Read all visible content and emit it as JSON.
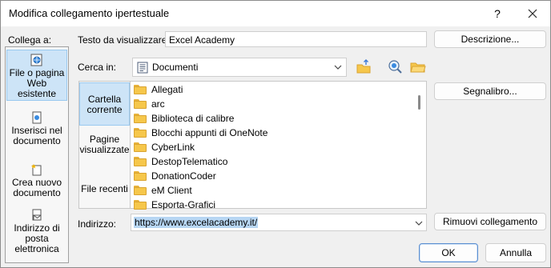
{
  "window": {
    "title": "Modifica collegamento ipertestuale",
    "help_glyph": "?"
  },
  "sidebar": {
    "header": "Collega a:",
    "items": [
      {
        "label": "File o pagina Web esistente",
        "icon": "web-page-icon",
        "active": true
      },
      {
        "label": "Inserisci nel documento",
        "icon": "document-place-icon",
        "active": false
      },
      {
        "label": "Crea nuovo documento",
        "icon": "new-document-icon",
        "active": false
      },
      {
        "label": "Indirizzo di posta elettronica",
        "icon": "email-icon",
        "active": false
      }
    ]
  },
  "display_text": {
    "label": "Testo da visualizzare:",
    "value": "Excel Academy"
  },
  "buttons": {
    "descrizione": "Descrizione...",
    "segnalibro": "Segnalibro...",
    "rimuovi": "Rimuovi collegamento",
    "ok": "OK",
    "annulla": "Annulla"
  },
  "look_in": {
    "label": "Cerca in:",
    "value": "Documenti"
  },
  "nav": {
    "items": [
      {
        "label": "Cartella corrente",
        "active": true
      },
      {
        "label": "Pagine visualizzate",
        "active": false
      },
      {
        "label": "File recenti",
        "active": false
      }
    ]
  },
  "files": [
    "Allegati",
    "arc",
    "Biblioteca di calibre",
    "Blocchi appunti di OneNote",
    "CyberLink",
    "DestopTelematico",
    "DonationCoder",
    "eM Client",
    "Esporta-Grafici"
  ],
  "address": {
    "label": "Indirizzo:",
    "value": "https://www.excelacademy.it/"
  },
  "colors": {
    "accent": "#0078d4",
    "selection": "#cde4f7",
    "folder": "#f6c74b"
  }
}
